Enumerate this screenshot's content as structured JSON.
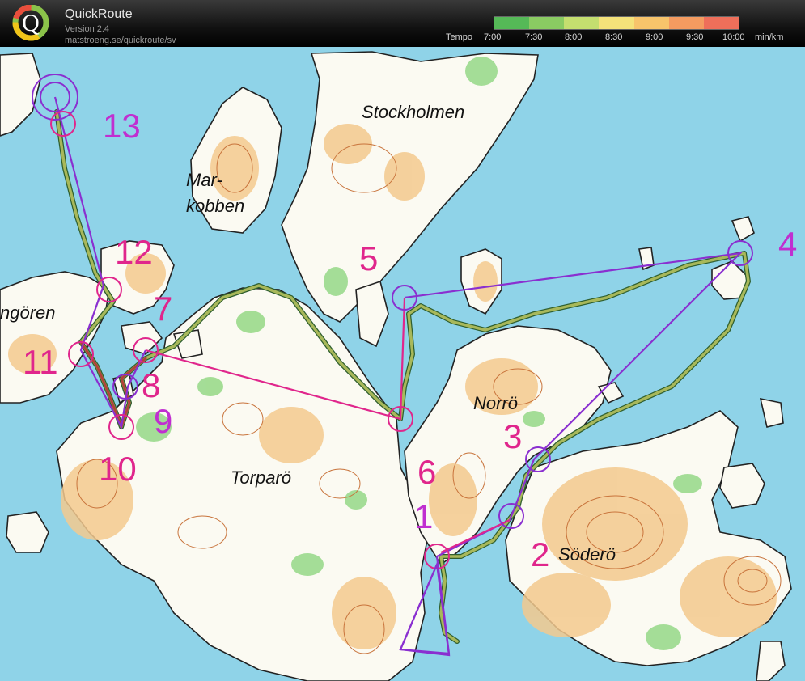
{
  "header": {
    "title": "QuickRoute",
    "version": "Version 2.4",
    "url": "matstroeng.se/quickroute/sv",
    "logo_letter": "Q",
    "tempo_label": "Tempo",
    "tempo_ticks": [
      "7:00",
      "7:30",
      "8:00",
      "8:30",
      "9:00",
      "9:30",
      "10:00"
    ],
    "tempo_unit": "min/km",
    "scale_colors": [
      "#55b957",
      "#8acb62",
      "#c4de6f",
      "#f4e27a",
      "#f7c46b",
      "#f49b60",
      "#ee6f5a"
    ]
  },
  "map": {
    "places": [
      "Stockholmen",
      "Mar-",
      "kobben",
      "Norrö",
      "Torparö",
      "Söderö",
      "ngören"
    ],
    "controls": [
      "1",
      "2",
      "3",
      "4",
      "5",
      "6",
      "7",
      "8",
      "9",
      "10",
      "11",
      "12",
      "13"
    ]
  }
}
